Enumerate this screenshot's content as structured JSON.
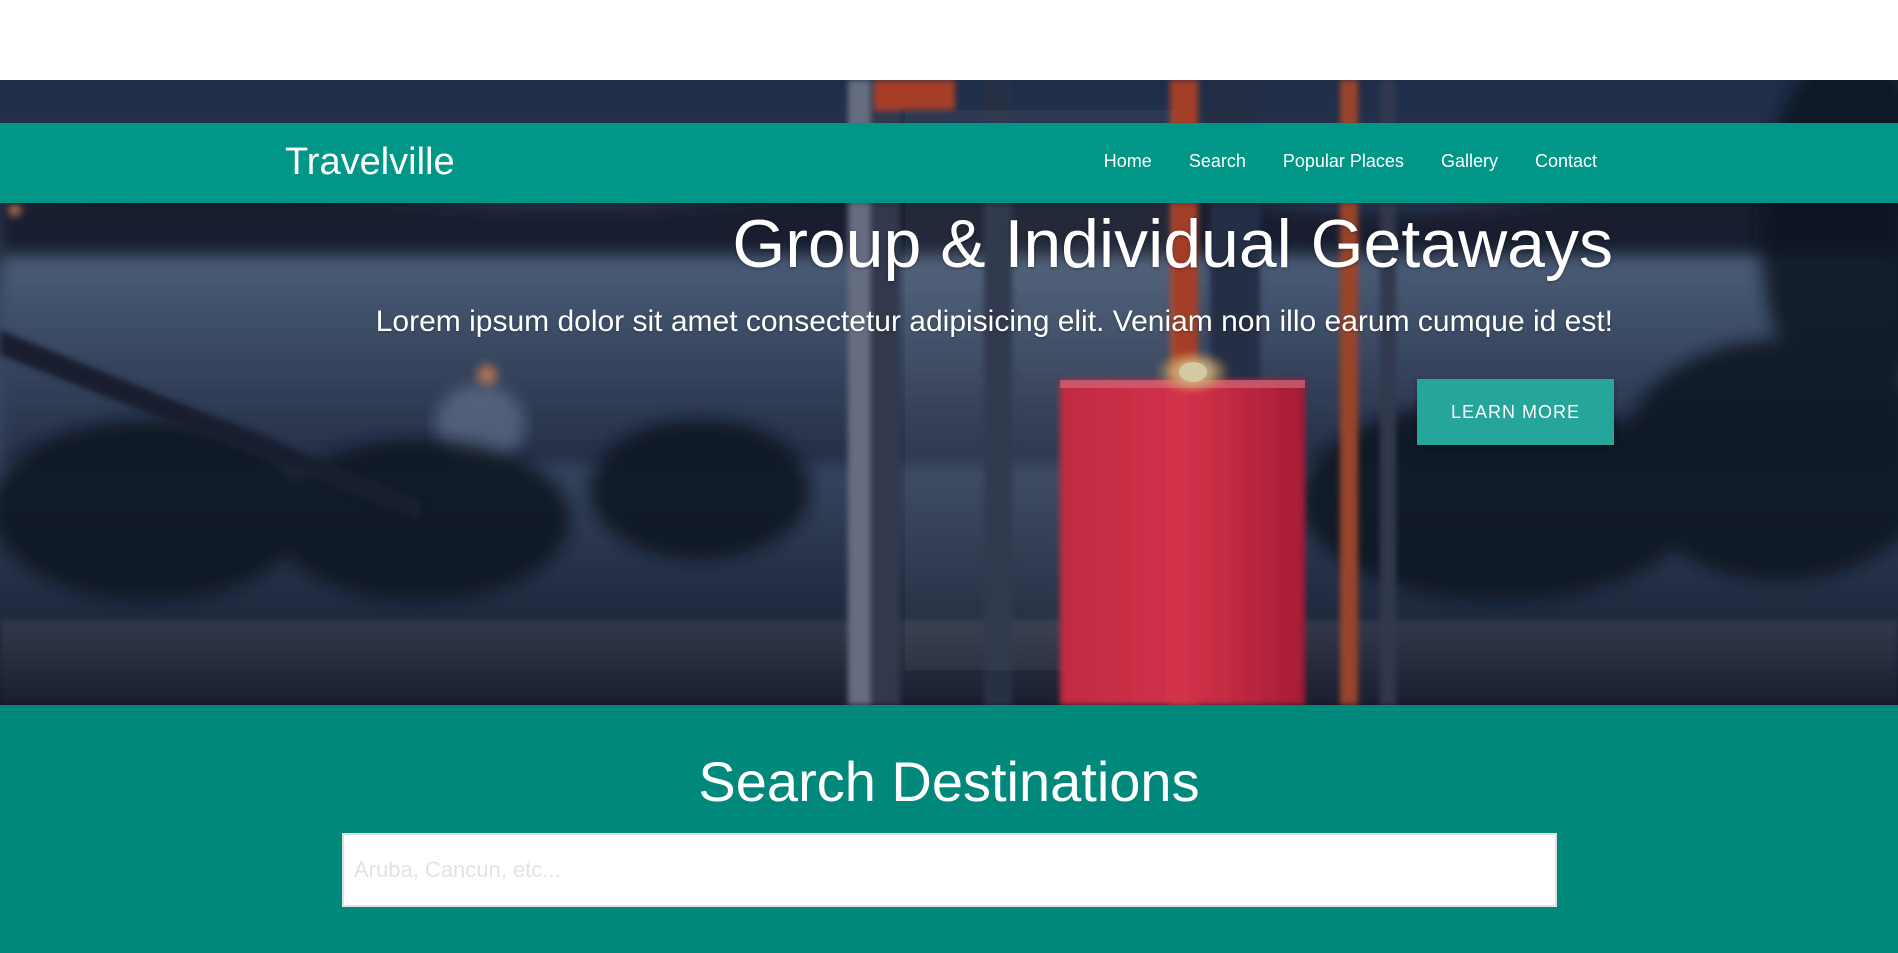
{
  "navbar": {
    "brand": "Travelville",
    "links": [
      {
        "label": "Home"
      },
      {
        "label": "Search"
      },
      {
        "label": "Popular Places"
      },
      {
        "label": "Gallery"
      },
      {
        "label": "Contact"
      }
    ]
  },
  "hero": {
    "title": "Group & Individual Getaways",
    "subtitle": "Lorem ipsum dolor sit amet consectetur adipisicing elit. Veniam non illo earum cumque id est!",
    "button_label": "LEARN MORE"
  },
  "search": {
    "title": "Search Destinations",
    "placeholder": "Aruba, Cancun, etc...",
    "value": ""
  },
  "colors": {
    "navbar": "#009688",
    "search_section": "#00897b",
    "button": "#26a69a",
    "text": "#ffffff"
  }
}
